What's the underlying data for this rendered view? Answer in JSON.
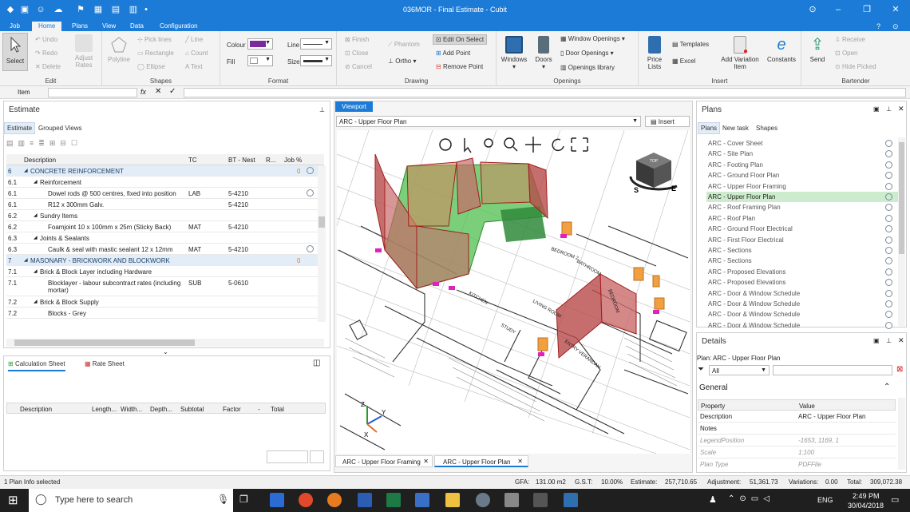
{
  "app": {
    "window_title": "036MOR - Final Estimate - Cubit",
    "tabs": [
      "Job",
      "Home",
      "Plans",
      "View",
      "Data",
      "Configuration"
    ],
    "active_tab": "Home"
  },
  "ribbon": {
    "edit": {
      "select": "Select",
      "undo": "Undo",
      "redo": "Redo",
      "delete": "Delete",
      "adjust_rates": "Adjust Rates",
      "label": "Edit"
    },
    "shapes": {
      "polyline": "Polyline",
      "pick_lines": "Pick lines",
      "rectangle": "Rectangle",
      "ellipse": "Ellipse",
      "line": "Line",
      "count": "Count",
      "text": "Text",
      "label": "Shapes"
    },
    "format": {
      "colour": "Colour",
      "fill": "Fill",
      "line": "Line",
      "size": "Size",
      "label": "Format"
    },
    "drawing": {
      "finish": "Finish",
      "close": "Close",
      "cancel": "Cancel",
      "phantom": "Phantom",
      "ortho": "Ortho",
      "edit_on_select": "Edit On Select",
      "add_point": "Add Point",
      "remove_point": "Remove Point",
      "label": "Drawing"
    },
    "openings": {
      "windows": "Windows",
      "doors": "Doors",
      "window_openings": "Window Openings",
      "door_openings": "Door Openings",
      "openings_library": "Openings library",
      "label": "Openings"
    },
    "insert": {
      "price_lists": "Price Lists",
      "templates": "Templates",
      "excel": "Excel",
      "add_variation_item": "Add Variation Item",
      "constants": "Constants",
      "label": "Insert"
    },
    "bartender": {
      "send": "Send",
      "receive": "Receive",
      "open": "Open",
      "hide_picked": "Hide Picked",
      "label": "Bartender"
    }
  },
  "formula": {
    "label": "Item",
    "fx": "fx"
  },
  "estimate": {
    "title": "Estimate",
    "tabs": [
      "Estimate",
      "Grouped Views"
    ],
    "columns": [
      "Description",
      "TC",
      "BT - Nest",
      "R...",
      "Job %"
    ],
    "rows": [
      {
        "num": "6",
        "desc": "CONCRETE REINFORCEMENT",
        "tc": "",
        "bt": "",
        "val": "0",
        "hdr": true
      },
      {
        "num": "6.1",
        "desc": "Reinforcement",
        "tc": "",
        "bt": ""
      },
      {
        "num": "6.1",
        "desc": "Dowel rods @ 500 centres, fixed into position",
        "tc": "LAB",
        "bt": "5-4210"
      },
      {
        "num": "6.1",
        "desc": "R12 x 300mm Galv.",
        "tc": "",
        "bt": "5-4210"
      },
      {
        "num": "6.2",
        "desc": "Sundry Items",
        "tc": "",
        "bt": ""
      },
      {
        "num": "6.2",
        "desc": "Foamjoint 10 x 100mm x 25m (Sticky Back)",
        "tc": "MAT",
        "bt": "5-4210"
      },
      {
        "num": "6.3",
        "desc": "Joints & Sealants",
        "tc": "",
        "bt": ""
      },
      {
        "num": "6.3",
        "desc": "Caulk & seal with mastic sealant 12 x 12mm",
        "tc": "MAT",
        "bt": "5-4210"
      },
      {
        "num": "7",
        "desc": "MASONARY - BRICKWORK AND BLOCKWORK",
        "tc": "",
        "bt": "",
        "val": "0",
        "hdr": true
      },
      {
        "num": "7.1",
        "desc": "Brick & Block Layer including Hardware",
        "tc": "",
        "bt": ""
      },
      {
        "num": "7.1",
        "desc": "Blocklayer - labour subcontract rates (including mortar)",
        "tc": "SUB",
        "bt": "5-0610"
      },
      {
        "num": "7.2",
        "desc": "Brick & Block Supply",
        "tc": "",
        "bt": ""
      },
      {
        "num": "7.2",
        "desc": "Blocks - Grey",
        "tc": "",
        "bt": ""
      }
    ]
  },
  "calc": {
    "tabs": [
      "Calculation Sheet",
      "Rate Sheet"
    ],
    "columns": [
      "Description",
      "Length...",
      "Width...",
      "Depth...",
      "Subtotal",
      "Factor",
      "-",
      "Total"
    ]
  },
  "viewport": {
    "tab": "Viewport",
    "plan_select": "ARC - Upper Floor Plan",
    "insert": "Insert",
    "bottom_tabs": [
      "ARC - Upper Floor Framing",
      "ARC - Upper Floor Plan"
    ],
    "cube_labels": [
      "TOP",
      "S",
      "E"
    ],
    "axis": [
      "Y",
      "Z",
      "X"
    ],
    "room_labels": [
      "BEDROOM 2",
      "BATHROOM",
      "LIVING ROOM",
      "KITCHEN",
      "STUDY",
      "BEDROOM",
      "ENTRY VERANDAH"
    ]
  },
  "plans": {
    "title": "Plans",
    "tabs": [
      "Plans",
      "New task",
      "Shapes"
    ],
    "selected": "ARC - Upper Floor Plan",
    "items": [
      "ARC - Cover Sheet",
      "ARC - Site Plan",
      "ARC - Footing Plan",
      "ARC - Ground Floor Plan",
      "ARC - Upper Floor Framing",
      "ARC - Upper Floor Plan",
      "ARC - Roof Framing Plan",
      "ARC - Roof Plan",
      "ARC - Ground Floor Electrical",
      "ARC - First Floor Electrical",
      "ARC - Sections",
      "ARC - Sections",
      "ARC - Proposed Elevations",
      "ARC - Proposed Elevations",
      "ARC - Door & Window Schedule",
      "ARC - Door & Window Schedule",
      "ARC - Door & Window Schedule",
      "ARC - Door & Window Schedule"
    ]
  },
  "details": {
    "title": "Details",
    "plan_label": "Plan: ARC - Upper Floor Plan",
    "filter": "All",
    "section": "General",
    "columns": [
      "Property",
      "Value"
    ],
    "rows": [
      {
        "k": "Description",
        "v": "ARC - Upper Floor Plan",
        "bold": true
      },
      {
        "k": "Notes",
        "v": ""
      },
      {
        "k": "LegendPosition",
        "v": "-1653, 1169, 1"
      },
      {
        "k": "Scale",
        "v": "1:100"
      },
      {
        "k": "Plan Type",
        "v": "PDFFile"
      }
    ]
  },
  "status": {
    "left": "1 Plan Info selected",
    "gfa_label": "GFA:",
    "gfa": "131.00 m2",
    "gst_label": "G.S.T:",
    "gst": "10.00%",
    "estimate_label": "Estimate:",
    "estimate": "257,710.65",
    "adjustment_label": "Adjustment:",
    "adjustment": "51,361.73",
    "variations_label": "Variations:",
    "variations": "0.00",
    "total_label": "Total:",
    "total": "309,072.38"
  },
  "taskbar": {
    "search_placeholder": "Type here to search",
    "lang": "ENG",
    "time": "2:49 PM",
    "date": "30/04/2018"
  },
  "colors": {
    "accent": "#1c7bd6",
    "selected_plan": "#cdeccd",
    "room_green": "#4fbf4f",
    "wall_red": "#b84a4a"
  }
}
